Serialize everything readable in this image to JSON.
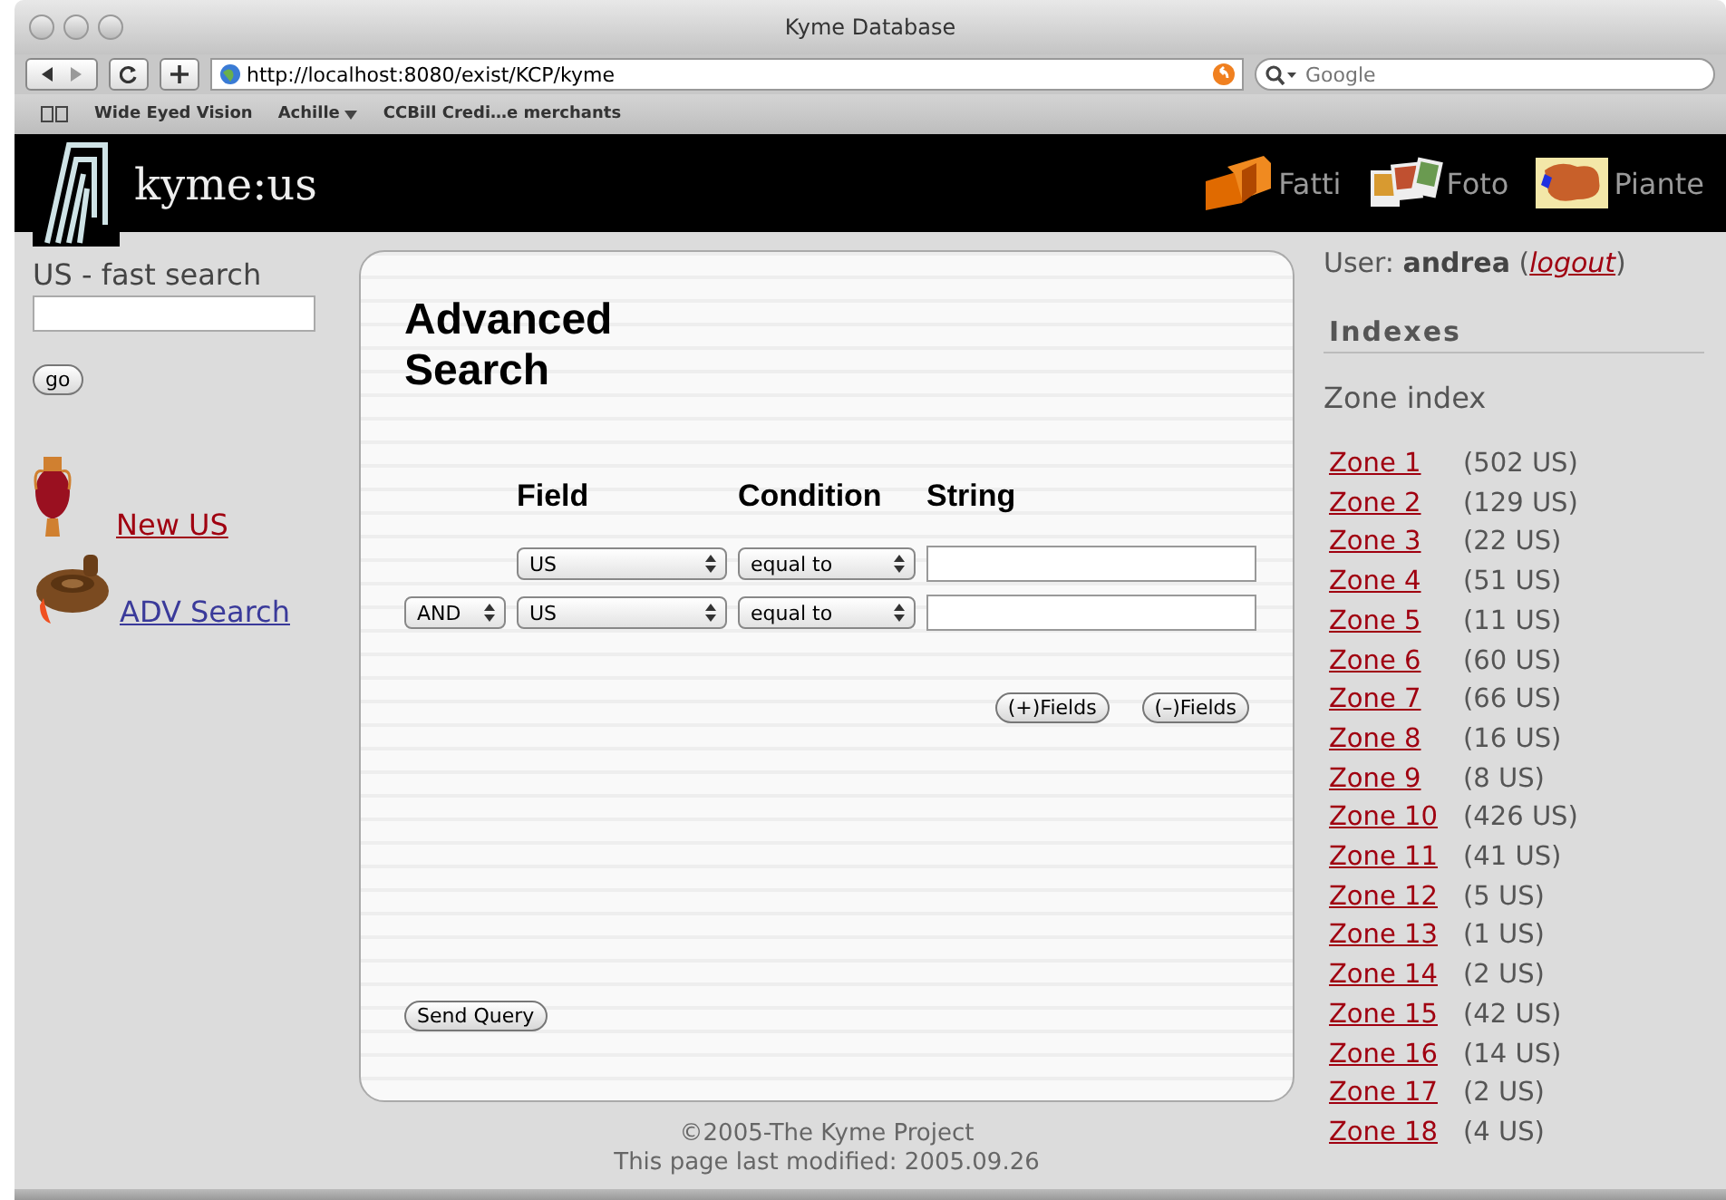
{
  "window": {
    "title": "Kyme Database"
  },
  "toolbar": {
    "address": "http://localhost:8080/exist/KCP/kyme",
    "search_placeholder": "Google"
  },
  "bookmarks": [
    {
      "label": "Wide Eyed Vision",
      "kind": "link"
    },
    {
      "label": "Achille",
      "kind": "folder"
    },
    {
      "label": "CCBill Credi…e merchants",
      "kind": "link"
    }
  ],
  "header": {
    "logo": "kyme:us",
    "nav": [
      {
        "label": "Fatti",
        "kind": "bricks"
      },
      {
        "label": "Foto",
        "kind": "photos"
      },
      {
        "label": "Piante",
        "kind": "map"
      }
    ]
  },
  "left": {
    "fast_search_label": "US - fast search",
    "go_button": "go",
    "links": [
      {
        "label": "New US",
        "kind": "vase"
      },
      {
        "label": "ADV Search",
        "kind": "lamp"
      }
    ]
  },
  "panel": {
    "title": "Advanced Search",
    "columns": [
      "Field",
      "Condition",
      "String"
    ],
    "rows": [
      {
        "field": "US",
        "condition": "equal to"
      },
      {
        "operator": "AND",
        "field": "US",
        "condition": "equal to"
      }
    ],
    "buttons": [
      "(+)Fields",
      "(–)Fields"
    ],
    "send_button": "Send Query"
  },
  "right": {
    "user": {
      "prefix": "User:",
      "name": "andrea",
      "open": "(",
      "link": "logout",
      "close": ")"
    },
    "heading": "Indexes",
    "subheading": "Zone index",
    "zones": [
      {
        "label": "Zone 1",
        "count": "(502 US)"
      },
      {
        "label": "Zone 2",
        "count": "(129 US)"
      },
      {
        "label": "Zone 3",
        "count": "(22 US)"
      },
      {
        "label": "Zone 4",
        "count": "(51 US)"
      },
      {
        "label": "Zone 5",
        "count": "(11 US)"
      },
      {
        "label": "Zone 6",
        "count": "(60 US)"
      },
      {
        "label": "Zone 7",
        "count": "(66 US)"
      },
      {
        "label": "Zone 8",
        "count": "(16 US)"
      },
      {
        "label": "Zone 9",
        "count": "(8 US)"
      },
      {
        "label": "Zone 10",
        "count": "(426 US)"
      },
      {
        "label": "Zone 11",
        "count": "(41 US)"
      },
      {
        "label": "Zone 12",
        "count": "(5 US)"
      },
      {
        "label": "Zone 13",
        "count": "(1 US)"
      },
      {
        "label": "Zone 14",
        "count": "(2 US)"
      },
      {
        "label": "Zone 15",
        "count": "(42 US)"
      },
      {
        "label": "Zone 16",
        "count": "(14 US)"
      },
      {
        "label": "Zone 17",
        "count": "(2 US)"
      },
      {
        "label": "Zone 18",
        "count": "(4 US)"
      }
    ]
  },
  "footer": {
    "copyright": "©2005-The Kyme Project",
    "modified": "This page last modified: 2005.09.26"
  }
}
